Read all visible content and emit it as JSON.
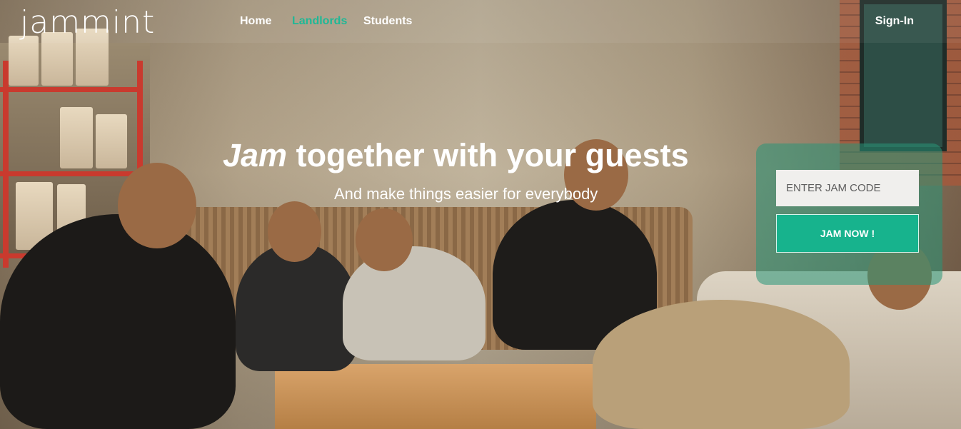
{
  "brand": {
    "logo_text": "jammint"
  },
  "nav": {
    "items": [
      {
        "label": "Home",
        "active": false
      },
      {
        "label": "Landlords",
        "active": true
      },
      {
        "label": "Students",
        "active": false
      }
    ],
    "signin_label": "Sign-In"
  },
  "hero": {
    "headline_emphasis": "Jam",
    "headline_rest": " together with your guests",
    "subheadline": "And make things easier for everybody"
  },
  "jam_form": {
    "placeholder": "ENTER JAM CODE",
    "button_label": "JAM NOW !"
  },
  "colors": {
    "accent": "#17b38d",
    "active_nav": "#1fb896",
    "text": "#ffffff"
  }
}
